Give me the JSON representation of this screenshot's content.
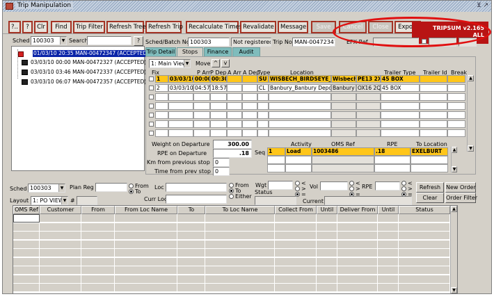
{
  "window": {
    "title": "Trip Manipulation",
    "brand": "TRIPSUM v2.165",
    "brand_sub": "ALL"
  },
  "toolbar": {
    "buttons": [
      "?..",
      "?",
      "Clr",
      "Find",
      "Trip Filter",
      "Refresh Tree",
      "Refresh Trip",
      "Recalculate Times",
      "Revalidate",
      "Message",
      "Save",
      "Cancel",
      "Close",
      "Export"
    ]
  },
  "sched": {
    "label": "Sched",
    "value": "100303",
    "search_label": "Search",
    "search_value": "",
    "q": "?"
  },
  "tree": {
    "items": [
      "01/03/10 20:35 MAN-00472347 (ACCEPTED)",
      "03/03/10 00:00 MAN-00472327 (ACCEPTED)",
      "03/03/10 03:46 MAN-00472337 (ACCEPTED)",
      "03/03/10 06:07 MAN-00472357 (ACCEPTED)"
    ]
  },
  "header": {
    "batch_label": "Sched/Batch No",
    "batch_value": "100303",
    "registered": "Not registered",
    "tripno_label": "Trip No",
    "tripno_value": "MAN-00472347",
    "efx_label": "EFX Ref."
  },
  "tabs": [
    "Trip Detail",
    "Stops",
    "Finance",
    "Audit"
  ],
  "stops": {
    "view": "1: Main View",
    "move_label": "Move",
    "up": "^",
    "down": "v",
    "columns": [
      "Fix",
      "P Arr",
      "P Dep",
      "A Arr",
      "A Dep",
      "Type",
      "Location",
      "Trailer Type",
      "Trailer Id",
      "Break"
    ],
    "rows": [
      {
        "no": "1",
        "date": "03/03/10",
        "parr": "00:00",
        "pdep": "00:30",
        "aarr": "",
        "adep": "",
        "type": "SU",
        "location": "WISBECH_BIRDSEYE_F",
        "town": "Wisbech",
        "post": "PE13 2X",
        "trailer": "45 BOX",
        "tid": "",
        "brk": ""
      },
      {
        "no": "2",
        "date": "03/03/10",
        "parr": "04:57",
        "pdep": "18:57",
        "aarr": "",
        "adep": "",
        "type": "CL",
        "location": "Banbury_Banbury Depo",
        "town": "Banbury",
        "post": "OX16 2Q",
        "trailer": "45 BOX",
        "tid": "",
        "brk": ""
      }
    ]
  },
  "summary": {
    "wod_label": "Weight on Departure",
    "wod_value": "300.00",
    "rpe_label": "RPE on Departure",
    "rpe_value": ".18",
    "seq_label": "Seq",
    "km_label": "Km from previous stop",
    "km_value": "0",
    "time_label": "Time from prev stop",
    "time_value": "0"
  },
  "activity": {
    "columns": [
      "Activity",
      "OMS Ref",
      "RPE",
      "To Location"
    ],
    "rows": [
      {
        "seq": "1",
        "activity": "Load",
        "oms": "1003486",
        "rpe": ".18",
        "to": "EXELBURT"
      }
    ]
  },
  "filters": {
    "sched_label": "Sched",
    "sched_value": "100303",
    "planreg_label": "Plan Reg",
    "from_label": "From",
    "to_label": "To",
    "loc_label": "Loc",
    "currloc_label": "Curr Loc",
    "loc_from": "From",
    "loc_to": "To",
    "loc_either": "Either",
    "wgt_label": "Wgt",
    "status_label": "Status",
    "vol_label": "Vol",
    "rpe_label": "RPE",
    "current_label": "Current",
    "layout_label": "Layout",
    "layout_value": "1: PO VIEW",
    "hash": "#",
    "refresh": "Refresh",
    "clear": "Clear",
    "new_order": "New Order",
    "order_filter": "Order Filter",
    "cmp": [
      "<",
      ">",
      "="
    ]
  },
  "orders": {
    "columns": [
      "OMS Ref",
      "Customer",
      "From",
      "From Loc Name",
      "To",
      "To Loc Name",
      "Collect From",
      "Until",
      "Deliver From",
      "Until",
      "Status"
    ]
  }
}
